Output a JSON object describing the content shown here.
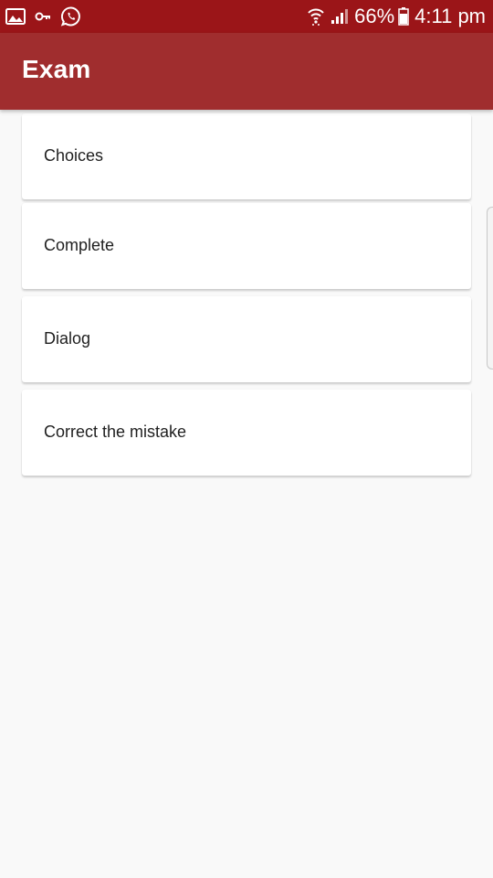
{
  "status_bar": {
    "battery_percent": "66%",
    "time": "4:11 pm",
    "icons": [
      "image-icon",
      "key-icon",
      "whatsapp-icon",
      "wifi-icon",
      "signal-icon",
      "battery-icon"
    ],
    "background_color": "#9b1518"
  },
  "app_bar": {
    "title": "Exam",
    "background_color": "#a02d2e"
  },
  "items": [
    {
      "label": "Choices"
    },
    {
      "label": "Complete"
    },
    {
      "label": "Dialog"
    },
    {
      "label": "Correct the mistake"
    }
  ]
}
